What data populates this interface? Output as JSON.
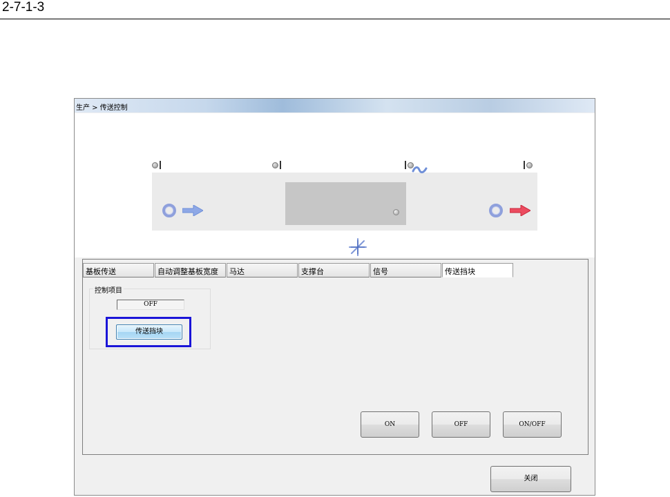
{
  "document": {
    "section_number": "2-7-1-3"
  },
  "window": {
    "title": "生产 > 传送控制"
  },
  "diagram": {
    "sensor_icon": "sensor-lamp-icon",
    "inlet_icon": "ring-sensor-icon",
    "inlet_arrow_icon": "blue-right-arrow-icon",
    "outlet_arrow_icon": "red-right-arrow-icon",
    "motor_icon": "wave-motor-icon",
    "fan_icon": "fan-icon",
    "colors": {
      "inlet_arrow": "#7f9fe0",
      "outlet_arrow": "#e8344f",
      "stage": "#c6c6c6"
    }
  },
  "tabs": [
    {
      "label": "基板传送"
    },
    {
      "label": "自动调整基板宽度"
    },
    {
      "label": "马达"
    },
    {
      "label": "支撑台"
    },
    {
      "label": "信号"
    },
    {
      "label": "传送挡块",
      "active": true
    }
  ],
  "control_group": {
    "label": "控制项目",
    "status": "OFF",
    "button_label": "传送挡块"
  },
  "actions": {
    "on_label": "ON",
    "off_label": "OFF",
    "onoff_label": "ON/OFF"
  },
  "footer": {
    "close_label": "关闭"
  }
}
